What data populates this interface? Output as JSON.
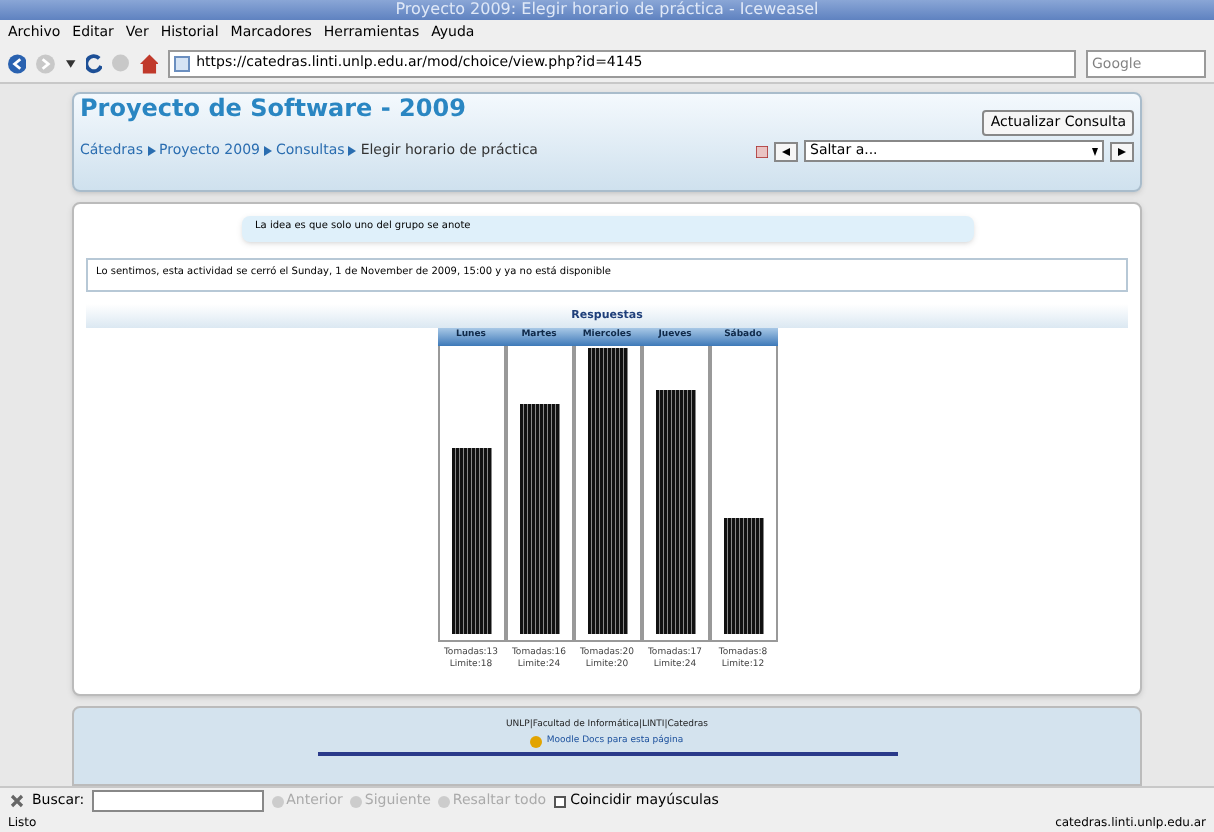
{
  "window": {
    "title": "Proyecto 2009: Elegir horario de práctica - Iceweasel"
  },
  "menu": [
    "Archivo",
    "Editar",
    "Ver",
    "Historial",
    "Marcadores",
    "Herramientas",
    "Ayuda"
  ],
  "toolbar": {
    "url": "https://catedras.linti.unlp.edu.ar/mod/choice/view.php?id=4145",
    "search_placeholder": "Google"
  },
  "header": {
    "title": "Proyecto de Software - 2009",
    "update_button": "Actualizar Consulta",
    "breadcrumb": [
      "Cátedras",
      "Proyecto 2009",
      "Consultas",
      "Elegir horario de práctica"
    ],
    "jump": "Saltar a..."
  },
  "intro": "La idea es que solo uno del grupo se anote",
  "notice": "Lo sentimos, esta actividad se cerró el Sunday, 1 de November de 2009, 15:00 y ya no está disponible",
  "results": {
    "title": "Respuestas",
    "options": [
      {
        "name": "Lunes",
        "level": 0.65,
        "taken": "Tomadas:13",
        "limit": "Limite:18"
      },
      {
        "name": "Martes",
        "level": 0.8,
        "taken": "Tomadas:16",
        "limit": "Limite:24"
      },
      {
        "name": "Miercoles",
        "level": 1.0,
        "taken": "Tomadas:20",
        "limit": "Limite:20"
      },
      {
        "name": "Jueves",
        "level": 0.85,
        "taken": "Tomadas:17",
        "limit": "Limite:24"
      },
      {
        "name": "Sábado",
        "level": 0.4,
        "taken": "Tomadas:8",
        "limit": "Limite:12"
      }
    ]
  },
  "footer": {
    "links": "UNLP|Facultad de Informática|LINTI|Catedras",
    "docs": "Moodle Docs para esta página"
  },
  "find_bar": {
    "label": "Buscar:",
    "buttons": [
      {
        "label": "Anterior",
        "disabled": true
      },
      {
        "label": "Siguiente",
        "disabled": true
      },
      {
        "label": "Resaltar todo",
        "disabled": true
      }
    ],
    "match_case": {
      "label": "Coincidir mayúsculas",
      "checked": false
    }
  },
  "status": {
    "text": "Listo",
    "host": "catedras.linti.unlp.edu.ar"
  }
}
